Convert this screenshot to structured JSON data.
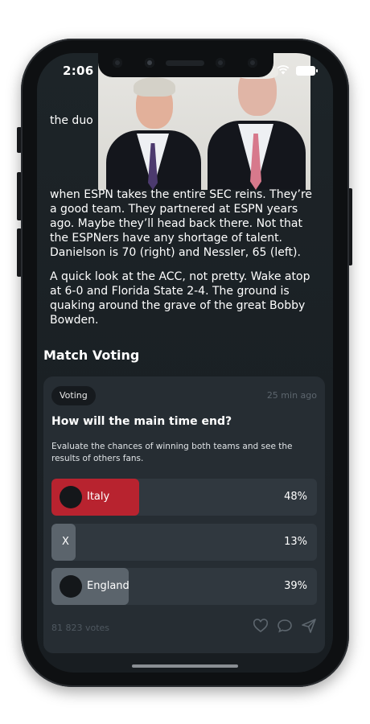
{
  "status_bar": {
    "time": "2:06"
  },
  "article": {
    "caption": "the duo",
    "paragraphs": [
      "when ESPN takes the entire SEC reins. They’re a good team. They partnered at ESPN years ago. Maybe they’ll head back there. Not that the ESPNers have any shortage of talent. Danielson is 70 (right) and Nessler, 65 (left).",
      "A quick look at the ACC, not pretty. Wake atop at 6-0 and Florida State 2-4. The ground is quaking around the grave of the great Bobby Bowden."
    ]
  },
  "section_title": "Match Voting",
  "poll": {
    "tag": "Voting",
    "time_ago": "25 min ago",
    "question": "How will the main time end?",
    "description": "Evaluate the chances of winning both teams and see the results of others fans.",
    "options": [
      {
        "label": "Italy",
        "percent_text": "48%",
        "share": 0.33,
        "color": "#b8232f",
        "has_flag": true
      },
      {
        "label": "X",
        "percent_text": "13%",
        "share": 0.09,
        "color": "#5b646c",
        "has_flag": false
      },
      {
        "label": "England",
        "percent_text": "39%",
        "share": 0.29,
        "color": "#5b646c",
        "has_flag": true
      }
    ],
    "votes": "81 823 votes",
    "action_icons": [
      "heart-icon",
      "comment-icon",
      "send-icon"
    ]
  },
  "colors": {
    "accent": "#b8232f",
    "background": "#1d2428",
    "card": "#262d33"
  }
}
